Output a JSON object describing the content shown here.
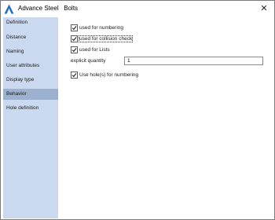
{
  "window": {
    "title": "Advance Steel   Bolts",
    "close_glyph": "✕",
    "app_icon": "advance-steel-logo"
  },
  "sidebar": {
    "items": [
      {
        "label": "Definition",
        "selected": false
      },
      {
        "label": "Distance",
        "selected": false
      },
      {
        "label": "Naming",
        "selected": false
      },
      {
        "label": "User attributes",
        "selected": false
      },
      {
        "label": "Display type",
        "selected": false
      },
      {
        "label": "Behavior",
        "selected": true
      },
      {
        "label": "Hole definition",
        "selected": false
      }
    ]
  },
  "behavior": {
    "used_for_numbering": {
      "label": "used for numbering",
      "checked": true
    },
    "used_for_collision_check": {
      "label": "used for collision check",
      "checked": true
    },
    "used_for_lists": {
      "label": "used for Lists",
      "checked": true
    },
    "explicit_quantity": {
      "label": "explicit quantity",
      "value": "1"
    },
    "use_holes_for_numbering": {
      "label": "Use hole(s) for numbering",
      "checked": true
    }
  },
  "colors": {
    "sidebar_bg": "#cbd9f0",
    "sidebar_selected_bg": "#9cb0cf",
    "logo_blue": "#1f6fc5"
  }
}
